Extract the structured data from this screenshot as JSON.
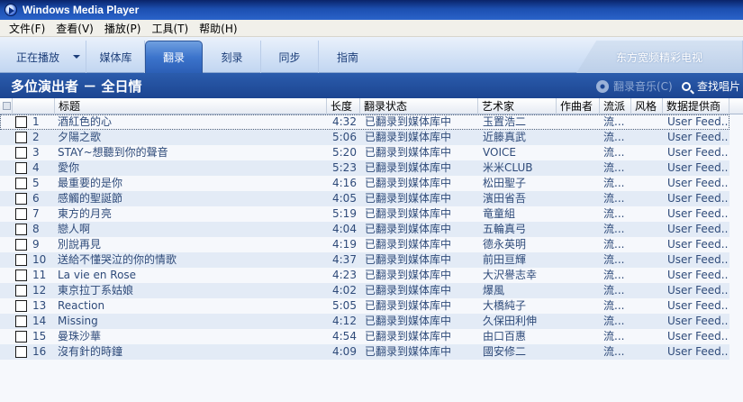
{
  "window": {
    "title": "Windows Media Player"
  },
  "menu": [
    {
      "label": "文件(F)"
    },
    {
      "label": "查看(V)"
    },
    {
      "label": "播放(P)"
    },
    {
      "label": "工具(T)"
    },
    {
      "label": "帮助(H)"
    }
  ],
  "tabs": {
    "now_playing": "正在播放",
    "library": "媒体库",
    "rip": "翻录",
    "burn": "刻录",
    "sync": "同步",
    "guide": "指南",
    "service": "东方宽频精彩电视"
  },
  "header": {
    "album_title": "多位演出者 － 全日情",
    "rip_music": "翻录音乐(C)",
    "find_album": "查找唱片"
  },
  "columns": {
    "title": "标题",
    "length": "长度",
    "rip_status": "翻录状态",
    "artist": "艺术家",
    "composer": "作曲者",
    "genre": "流派",
    "style": "风格",
    "provider": "数据提供商"
  },
  "tracks": [
    {
      "num": "1",
      "title": "酒紅色的心",
      "length": "4:32",
      "status": "已翻录到媒体库中",
      "artist": "玉置浩二",
      "composer": "",
      "genre": "流...",
      "style": "",
      "provider": "User Feed..."
    },
    {
      "num": "2",
      "title": "夕陽之歌",
      "length": "5:06",
      "status": "已翻录到媒体库中",
      "artist": "近籐真武",
      "composer": "",
      "genre": "流...",
      "style": "",
      "provider": "User Feed..."
    },
    {
      "num": "3",
      "title": "STAY~想聽到你的聲音",
      "length": "5:20",
      "status": "已翻录到媒体库中",
      "artist": "VOICE",
      "composer": "",
      "genre": "流...",
      "style": "",
      "provider": "User Feed..."
    },
    {
      "num": "4",
      "title": "愛你",
      "length": "5:23",
      "status": "已翻录到媒体库中",
      "artist": "米米CLUB",
      "composer": "",
      "genre": "流...",
      "style": "",
      "provider": "User Feed..."
    },
    {
      "num": "5",
      "title": "最重要的是你",
      "length": "4:16",
      "status": "已翻录到媒体库中",
      "artist": "松田聖子",
      "composer": "",
      "genre": "流...",
      "style": "",
      "provider": "User Feed..."
    },
    {
      "num": "6",
      "title": "感觸的聖誕節",
      "length": "4:05",
      "status": "已翻录到媒体库中",
      "artist": "濱田省吾",
      "composer": "",
      "genre": "流...",
      "style": "",
      "provider": "User Feed..."
    },
    {
      "num": "7",
      "title": "東方的月亮",
      "length": "5:19",
      "status": "已翻录到媒体库中",
      "artist": "竜童組",
      "composer": "",
      "genre": "流...",
      "style": "",
      "provider": "User Feed..."
    },
    {
      "num": "8",
      "title": "戀人啊",
      "length": "4:04",
      "status": "已翻录到媒体库中",
      "artist": "五輪真弓",
      "composer": "",
      "genre": "流...",
      "style": "",
      "provider": "User Feed..."
    },
    {
      "num": "9",
      "title": "別說再見",
      "length": "4:19",
      "status": "已翻录到媒体库中",
      "artist": "德永英明",
      "composer": "",
      "genre": "流...",
      "style": "",
      "provider": "User Feed..."
    },
    {
      "num": "10",
      "title": "送給不懂哭泣的你的情歌",
      "length": "4:37",
      "status": "已翻录到媒体库中",
      "artist": "前田亘輝",
      "composer": "",
      "genre": "流...",
      "style": "",
      "provider": "User Feed..."
    },
    {
      "num": "11",
      "title": "La vie en Rose",
      "length": "4:23",
      "status": "已翻录到媒体库中",
      "artist": "大沢譽志幸",
      "composer": "",
      "genre": "流...",
      "style": "",
      "provider": "User Feed..."
    },
    {
      "num": "12",
      "title": "東京拉丁系姑娘",
      "length": "4:02",
      "status": "已翻录到媒体库中",
      "artist": "爆風",
      "composer": "",
      "genre": "流...",
      "style": "",
      "provider": "User Feed..."
    },
    {
      "num": "13",
      "title": "Reaction",
      "length": "5:05",
      "status": "已翻录到媒体库中",
      "artist": "大橋純子",
      "composer": "",
      "genre": "流...",
      "style": "",
      "provider": "User Feed..."
    },
    {
      "num": "14",
      "title": "Missing",
      "length": "4:12",
      "status": "已翻录到媒体库中",
      "artist": "久保田利伸",
      "composer": "",
      "genre": "流...",
      "style": "",
      "provider": "User Feed..."
    },
    {
      "num": "15",
      "title": "曼珠沙華",
      "length": "4:54",
      "status": "已翻录到媒体库中",
      "artist": "由口百惠",
      "composer": "",
      "genre": "流...",
      "style": "",
      "provider": "User Feed..."
    },
    {
      "num": "16",
      "title": "沒有針的時鐘",
      "length": "4:09",
      "status": "已翻录到媒体库中",
      "artist": "國安修二",
      "composer": "",
      "genre": "流...",
      "style": "",
      "provider": "User Feed..."
    }
  ]
}
